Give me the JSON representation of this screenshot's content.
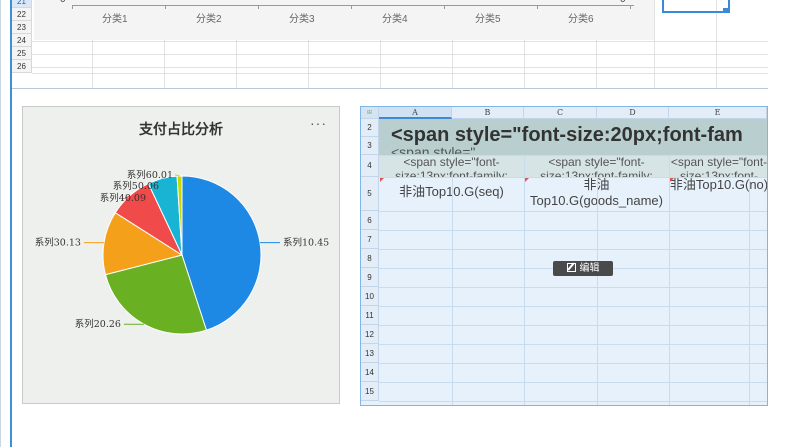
{
  "top_grid": {
    "row_numbers": [
      "21",
      "22",
      "23",
      "24",
      "25",
      "26"
    ],
    "active_row": "21",
    "chart": {
      "zero_label_left": "0",
      "zero_label_right": "0",
      "categories": [
        "分类1",
        "分类2",
        "分类3",
        "分类4",
        "分类5",
        "分类6"
      ]
    }
  },
  "pie_widget": {
    "title": "支付占比分析",
    "more_menu": "···"
  },
  "chart_data": {
    "type": "pie",
    "title": "支付占比分析",
    "slices": [
      {
        "label": "系列1",
        "value": 45,
        "display": "系列10.45",
        "color": "#1e88e5"
      },
      {
        "label": "系列2",
        "value": 26,
        "display": "系列20.26",
        "color": "#6ab023"
      },
      {
        "label": "系列3",
        "value": 13,
        "display": "系列30.13",
        "color": "#f5a01a"
      },
      {
        "label": "系列4",
        "value": 9,
        "display": "系列40.09",
        "color": "#f04a4a"
      },
      {
        "label": "系列5",
        "value": 6,
        "display": "系列50.06",
        "color": "#19b3d3"
      },
      {
        "label": "系列6",
        "value": 1,
        "display": "系列60.01",
        "color": "#c7d800"
      }
    ]
  },
  "sheet": {
    "columns": [
      "A",
      "B",
      "C",
      "D",
      "E"
    ],
    "rows": [
      "2",
      "3",
      "4",
      "5",
      "6",
      "7",
      "8",
      "9",
      "10",
      "11",
      "12",
      "13",
      "14",
      "15"
    ],
    "header_text": "<span style=\"font-size:20px;font-fam",
    "header_text_sub": "<span style=\"                 ...",
    "row4_cells": [
      "<span style=\"font-size:13px;font-family:",
      "<span style=\"font-size:13px;font-family:",
      "<span style=\"font-size:13px;font-family:"
    ],
    "row5_cells": [
      "非油Top10.G(seq)",
      "非油Top10.G(goods_name)",
      "非油Top10.G(no)"
    ],
    "edit_button": "编辑"
  }
}
